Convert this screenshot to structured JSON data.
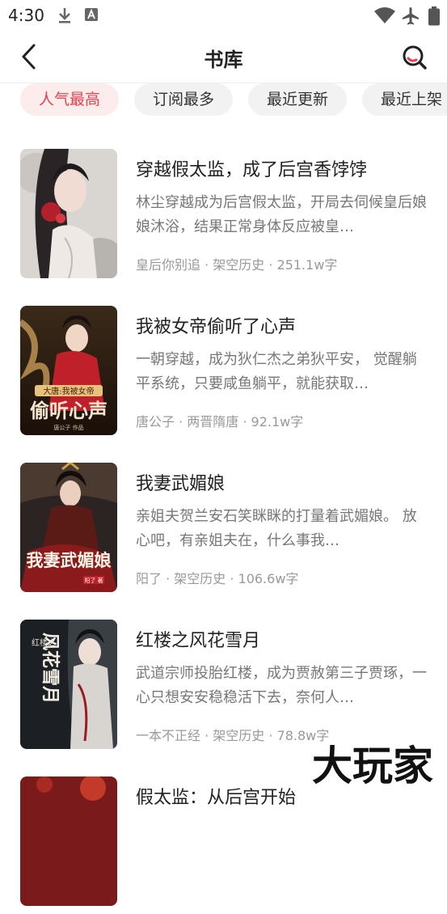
{
  "status": {
    "time": "4:30"
  },
  "header": {
    "title": "书库"
  },
  "tabs": [
    {
      "label": "人气最高",
      "active": true
    },
    {
      "label": "订阅最多",
      "active": false
    },
    {
      "label": "最近更新",
      "active": false
    },
    {
      "label": "最近上架",
      "active": false
    }
  ],
  "books": [
    {
      "title": "穿越假太监，成了后宫香饽饽",
      "desc": "林尘穿越成为后宫假太监，开局去伺候皇后娘娘沐浴，结果正常身体反应被皇…",
      "meta": "皇后你别追 · 架空历史 · 251.1w字"
    },
    {
      "title": "我被女帝偷听了心声",
      "desc": "一朝穿越，成为狄仁杰之弟狄平安， 觉醒躺平系统，只要咸鱼躺平，就能获取…",
      "meta": "唐公子 · 两晋隋唐 · 92.1w字",
      "cover_text": "大唐:我被女帝",
      "cover_big": "偷听心声",
      "cover_author": "唐公子 作品"
    },
    {
      "title": "我妻武媚娘",
      "desc": "亲姐夫贺兰安石笑眯眯的打量着武媚娘。 放心吧，有亲姐夫在，什么事我…",
      "meta": "阳了 · 架空历史 · 106.6w字",
      "cover_big": "我妻武媚娘",
      "cover_author": "阳了 著"
    },
    {
      "title": "红楼之风花雪月",
      "desc": "武道宗师投胎红楼，成为贾赦第三子贾琢，一心只想安安稳稳活下去，奈何人…",
      "meta": "一本不正经 · 架空历史 · 78.8w字",
      "cover_big": "风花雪月",
      "cover_small": "红楼之"
    },
    {
      "title": "假太监：从后宫开始",
      "desc": "",
      "meta": ""
    }
  ],
  "watermark": "大玩家",
  "colors": {
    "accent": "#e8414e",
    "tab_bg": "#f2f2f2"
  }
}
